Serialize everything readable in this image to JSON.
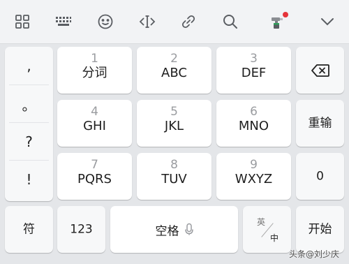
{
  "toolbar": {
    "icons": [
      "grid-icon",
      "keyboard-icon",
      "emoji-icon",
      "cursor-icon",
      "link-icon",
      "search-icon",
      "skin-icon",
      "collapse-icon"
    ],
    "badge_color": "#e5343a"
  },
  "punctuation": [
    ",",
    "。",
    "?",
    "!"
  ],
  "keys": {
    "k1": {
      "digit": "1",
      "letters": "分词"
    },
    "k2": {
      "digit": "2",
      "letters": "ABC"
    },
    "k3": {
      "digit": "3",
      "letters": "DEF"
    },
    "k4": {
      "digit": "4",
      "letters": "GHI"
    },
    "k5": {
      "digit": "5",
      "letters": "JKL"
    },
    "k6": {
      "digit": "6",
      "letters": "MNO"
    },
    "k7": {
      "digit": "7",
      "letters": "PQRS"
    },
    "k8": {
      "digit": "8",
      "letters": "TUV"
    },
    "k9": {
      "digit": "9",
      "letters": "WXYZ"
    },
    "k0": {
      "label": "0"
    }
  },
  "function_keys": {
    "backspace_icon": "backspace-icon",
    "reenter": "重输",
    "symbols": "符",
    "numbers": "123",
    "space": "空格",
    "lang_top": "英",
    "lang_bottom": "中",
    "start": "开始"
  },
  "watermark": "头条@刘少庆"
}
